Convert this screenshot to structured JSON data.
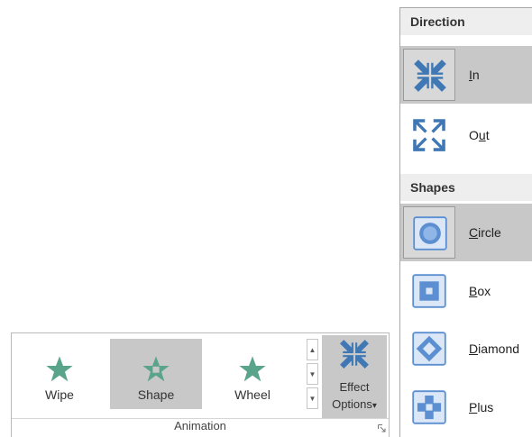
{
  "ribbon": {
    "animations": [
      {
        "label": "Wipe",
        "selected": false
      },
      {
        "label": "Shape",
        "selected": true
      },
      {
        "label": "Wheel",
        "selected": false
      }
    ],
    "effect_options": {
      "line1": "Effect",
      "line2": "Options",
      "arrow": "▾",
      "icon": "shrink-arrows-icon"
    },
    "group_label": "Animation",
    "scroll_up": "▲",
    "scroll_down": "▼",
    "scroll_more": "▼"
  },
  "menu": {
    "sections": [
      {
        "title": "Direction",
        "items": [
          {
            "pre": "",
            "u": "I",
            "post": "n",
            "icon": "arrows-in-icon",
            "selected": true
          },
          {
            "pre": "O",
            "u": "u",
            "post": "t",
            "icon": "arrows-out-icon",
            "selected": false
          }
        ]
      },
      {
        "title": "Shapes",
        "items": [
          {
            "pre": "",
            "u": "C",
            "post": "ircle",
            "icon": "circle-shape-icon",
            "selected": true
          },
          {
            "pre": "",
            "u": "B",
            "post": "ox",
            "icon": "box-shape-icon",
            "selected": false
          },
          {
            "pre": "",
            "u": "D",
            "post": "iamond",
            "icon": "diamond-shape-icon",
            "selected": false
          },
          {
            "pre": "",
            "u": "P",
            "post": "lus",
            "icon": "plus-shape-icon",
            "selected": false
          }
        ]
      }
    ]
  },
  "colors": {
    "star": "#5ba48c",
    "arrow": "#3f78b5",
    "shape_fill": "#5b8fd1",
    "selected_bg": "#c8c8c8",
    "header_bg": "#eeeeee"
  }
}
